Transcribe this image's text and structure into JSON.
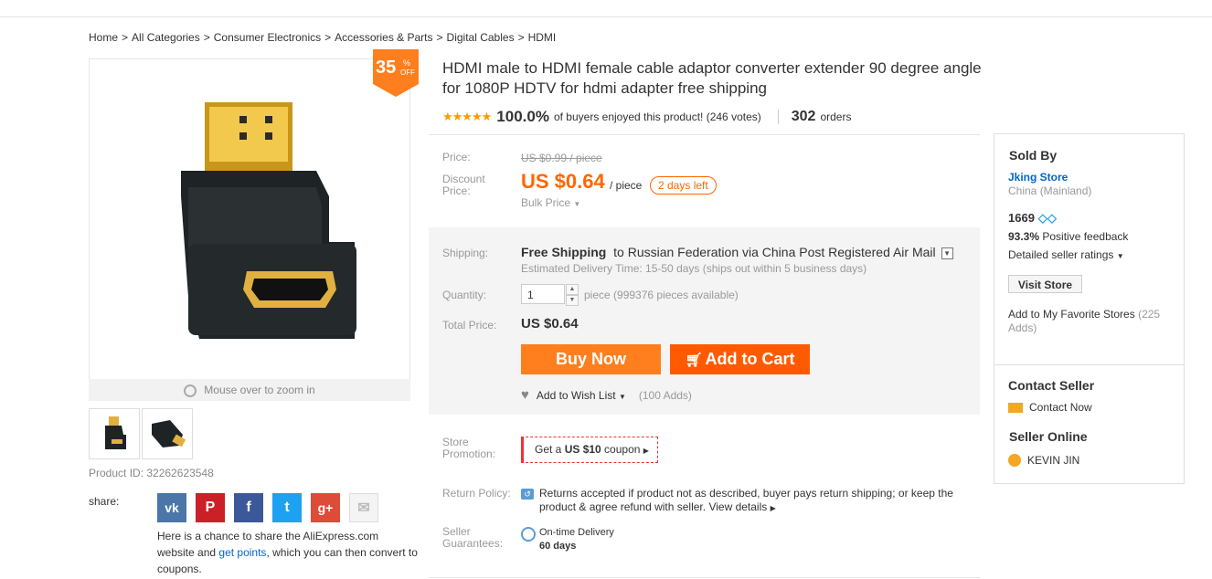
{
  "breadcrumb": [
    "Home",
    "All Categories",
    "Consumer Electronics",
    "Accessories & Parts",
    "Digital Cables",
    "HDMI"
  ],
  "discount": {
    "percent": "35",
    "symbol": "%",
    "off": "OFF",
    "color": "#ff7e1d"
  },
  "gallery": {
    "zoom_hint": "Mouse over to zoom in",
    "thumbnails": [
      "hdmi-adapter-front",
      "hdmi-adapter-side"
    ]
  },
  "product_id": "Product ID: 32262623548",
  "share": {
    "label": "share:",
    "networks": [
      "vk-icon",
      "pinterest-icon",
      "facebook-icon",
      "twitter-icon",
      "google-plus-icon",
      "email-icon"
    ],
    "text_before": "Here is a chance to share the AliExpress.com website and ",
    "link": "get points",
    "text_after": ", which you can then convert to coupons."
  },
  "product": {
    "title": "HDMI male to HDMI female cable adaptor converter extender 90 degree angle for 1080P HDTV for hdmi adapter free shipping",
    "stars": "★★★★★",
    "rating_pct": "100.0%",
    "rating_text": "of buyers enjoyed this product! (246 votes)",
    "orders_count": "302",
    "orders_label": "orders"
  },
  "price": {
    "label": "Price:",
    "original": "US $0.99 / piece",
    "discount_label_1": "Discount",
    "discount_label_2": "Price:",
    "discounted": "US $0.64",
    "per_piece": "/ piece",
    "days_left": "2 days left",
    "bulk": "Bulk Price",
    "accent": "#ff6600"
  },
  "shipping": {
    "label": "Shipping:",
    "method": "Free Shipping",
    "to": "to",
    "destination": "Russian Federation via China Post Registered Air Mail",
    "estimate": "Estimated Delivery Time: 15-50 days (ships out within 5 business days)"
  },
  "quantity": {
    "label": "Quantity:",
    "value": "1",
    "available": "piece (999376 pieces available)"
  },
  "total": {
    "label": "Total Price:",
    "value": "US $0.64"
  },
  "actions": {
    "buy_now": "Buy Now",
    "add_to_cart": "Add to Cart",
    "wish_list": "Add to Wish List",
    "wish_adds": "(100 Adds)"
  },
  "promotion": {
    "label_1": "Store",
    "label_2": "Promotion:",
    "coupon_prefix": "Get a ",
    "coupon_amount": "US $10",
    "coupon_suffix": " coupon"
  },
  "return_policy": {
    "label": "Return Policy:",
    "text": "Returns accepted if product not as described, buyer pays return shipping; or keep the product & agree refund with seller.",
    "link": "View details"
  },
  "guarantee": {
    "label_1": "Seller",
    "label_2": "Guarantees:",
    "title": "On-time Delivery",
    "days": "60 days"
  },
  "seller": {
    "heading": "Sold By",
    "store": "Jking Store",
    "location": "China (Mainland)",
    "score": "1669",
    "feedback_pct": "93.3%",
    "feedback_label": "Positive feedback",
    "detailed_ratings": "Detailed seller ratings",
    "visit_store": "Visit Store",
    "favorite": "Add to My Favorite Stores",
    "favorite_count": "(225 Adds)",
    "contact_heading": "Contact Seller",
    "contact_now": "Contact Now",
    "online_heading": "Seller Online",
    "online_name": "KEVIN JIN"
  }
}
